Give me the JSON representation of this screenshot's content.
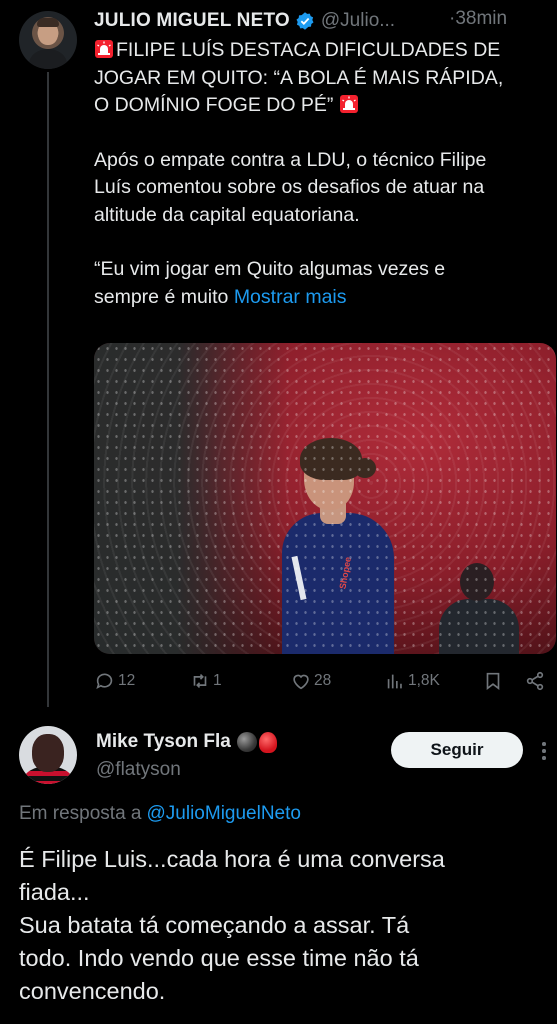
{
  "tweet": {
    "author_name": "JULIO MIGUEL NETO",
    "handle": "@Julio...",
    "time": "·38min",
    "headline_line1": "FILIPE LUÍS DESTACA DIFICULDADES DE",
    "headline_line2": "JOGAR EM QUITO: “A BOLA É MAIS RÁPIDA,",
    "headline_line3": "O DOMÍNIO FOGE DO PÉ”",
    "para1_line1": "Após o empate contra a LDU, o técnico Filipe",
    "para1_line2": "Luís comentou sobre os desafios de atuar na",
    "para1_line3": "altitude da capital equatoriana.",
    "para2_line1": "“Eu vim jogar em Quito algumas vezes e",
    "para2_line2": "sempre é muito",
    "show_more": "Mostrar mais",
    "stats": {
      "replies": "12",
      "retweets": "1",
      "likes": "28",
      "views": "1,8K"
    }
  },
  "reply": {
    "author_name": "Mike Tyson Fla",
    "handle": "@flatyson",
    "follow_label": "Seguir",
    "in_reply_prefix": "Em resposta a",
    "in_reply_handle": "@JulioMiguelNeto",
    "line1": "É Filipe Luis...cada hora é uma conversa",
    "line2": "fiada...",
    "line3": "Sua batata tá começando a assar. Tá",
    "line4": "todo. Indo vendo que esse time não tá",
    "line5": "convencendo."
  },
  "colors": {
    "background": "#000000",
    "text": "#e7e9ea",
    "muted": "#71767b",
    "link": "#1d9bf0",
    "verified": "#1d9bf0",
    "siren": "#f4212e"
  },
  "icons": [
    "verified-badge-icon",
    "siren-icon",
    "reply-icon",
    "retweet-icon",
    "like-icon",
    "views-icon",
    "bookmark-icon",
    "share-icon",
    "more-icon"
  ]
}
